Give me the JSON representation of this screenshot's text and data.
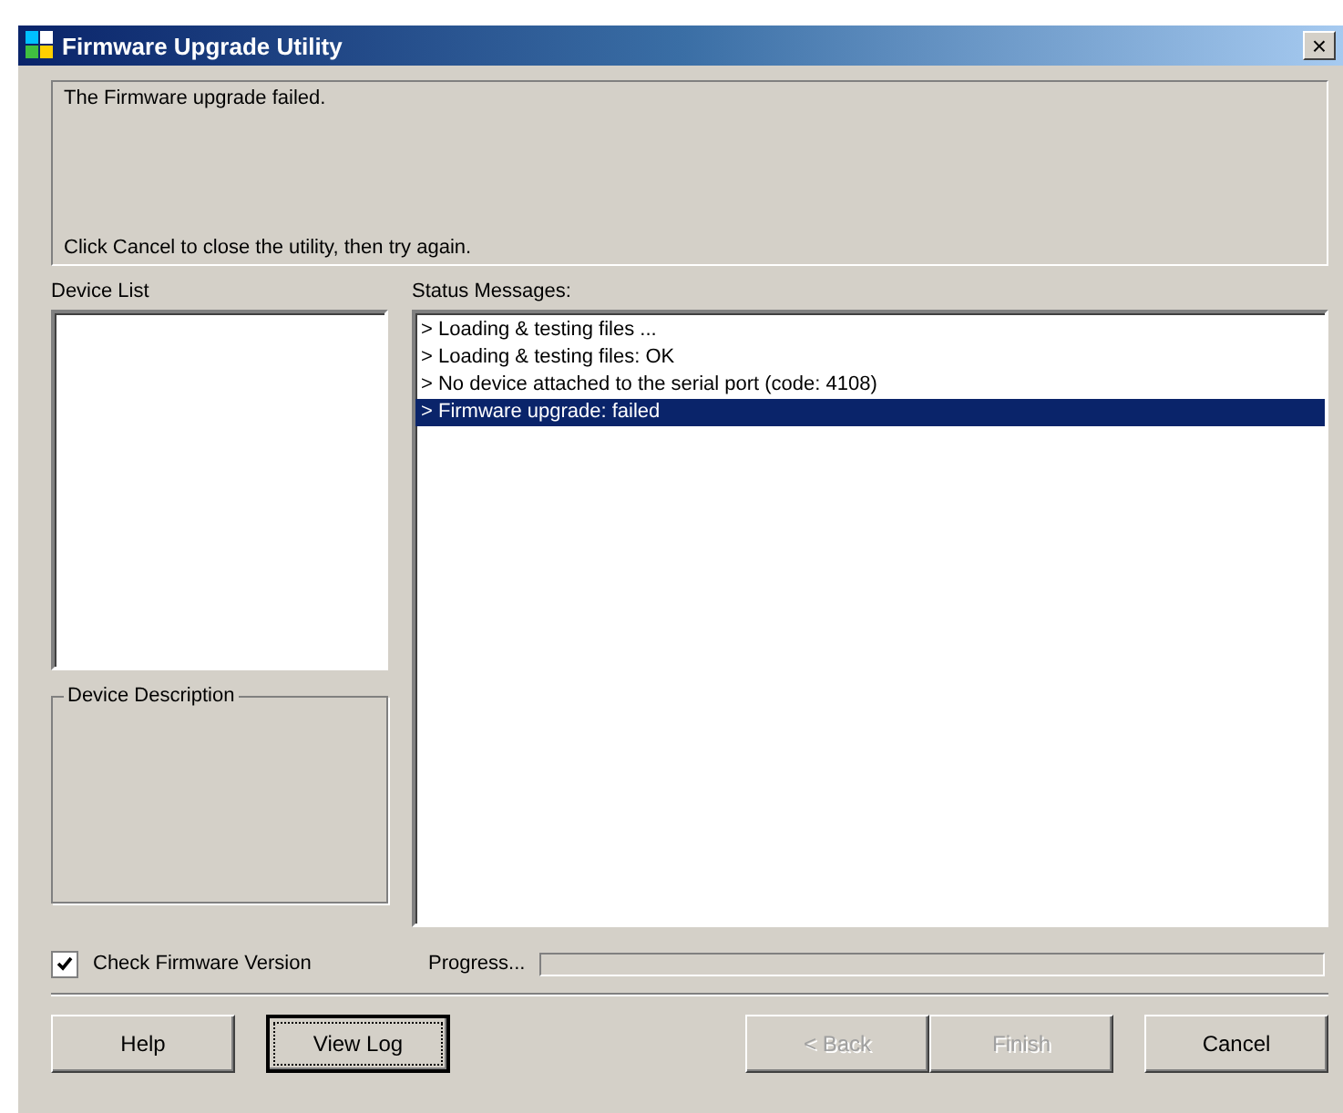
{
  "window": {
    "title": "Firmware Upgrade Utility",
    "close": "×"
  },
  "message": {
    "headline": "The Firmware upgrade failed.",
    "instruction": "Click Cancel to close the utility, then try again."
  },
  "device_list": {
    "label": "Device List"
  },
  "device_description": {
    "label": "Device Description"
  },
  "status_messages": {
    "label": "Status Messages:",
    "items": [
      {
        "text": "> Loading & testing files ...",
        "selected": false
      },
      {
        "text": "> Loading & testing files: OK",
        "selected": false
      },
      {
        "text": "> No device attached to the serial port (code: 4108)",
        "selected": false
      },
      {
        "text": "> Firmware upgrade: failed",
        "selected": true
      }
    ]
  },
  "check_firmware": {
    "label": "Check Firmware Version",
    "checked": true
  },
  "progress": {
    "label": "Progress...",
    "level": 0
  },
  "left_buttons": [
    {
      "label": "Help",
      "disabled": false,
      "focused": false
    },
    {
      "label": "View Log",
      "disabled": false,
      "focused": true
    }
  ],
  "right_buttons": [
    {
      "label": "< Back",
      "disabled": true,
      "focused": false
    },
    {
      "label": "Finish",
      "disabled": true,
      "focused": false
    },
    {
      "label": "Cancel",
      "disabled": false,
      "focused": false
    }
  ]
}
